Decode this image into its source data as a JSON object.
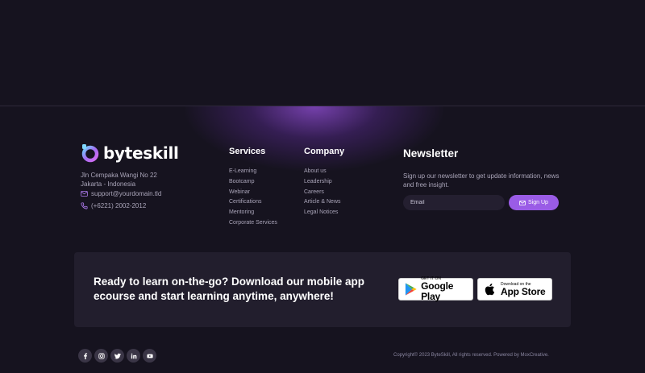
{
  "brand": {
    "name": "byteskill",
    "accent": "#9a5ce6"
  },
  "contact": {
    "address_line1": "Jln Cempaka Wangi No 22",
    "address_line2": "Jakarta - Indonesia",
    "email": "support@yourdomain.tld",
    "phone": "(+6221) 2002-2012",
    "email_icon": "mail-icon",
    "phone_icon": "phone-icon"
  },
  "services": {
    "title": "Services",
    "items": [
      "E-Learning",
      "Bootcamp",
      "Webinar",
      "Certifications",
      "Mentoring",
      "Corporate Services"
    ]
  },
  "company": {
    "title": "Company",
    "items": [
      "About us",
      "Leadership",
      "Careers",
      "Article & News",
      "Legal Notices"
    ]
  },
  "newsletter": {
    "title": "Newsletter",
    "text": "Sign up our newsletter to get update information, news and free insight.",
    "placeholder": "Email",
    "button": "Sign Up"
  },
  "cta": {
    "text": "Ready to learn on-the-go? Download our mobile app ecourse and start learning anytime, anywhere!",
    "google_play": {
      "small": "GET IT ON",
      "big": "Google Play"
    },
    "app_store": {
      "small": "Download on the",
      "big": "App Store"
    }
  },
  "socials": [
    "facebook-icon",
    "instagram-icon",
    "twitter-icon",
    "linkedin-icon",
    "youtube-icon"
  ],
  "copyright": "Copyright© 2023 ByteSkill, All rights reserved. Powered by MoxCreative."
}
